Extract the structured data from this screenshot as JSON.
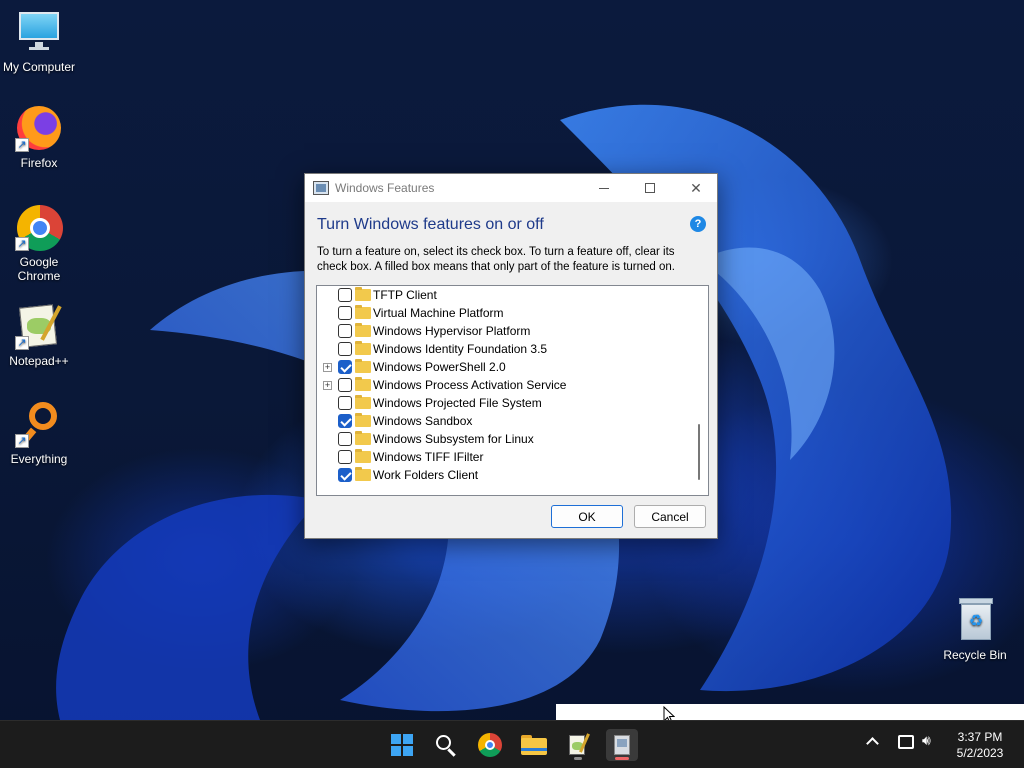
{
  "desktop": {
    "icons": [
      {
        "label": "My Computer",
        "icon": "monitor-icon"
      },
      {
        "label": "Firefox",
        "icon": "firefox-icon"
      },
      {
        "label": "Google Chrome",
        "icon": "chrome-icon"
      },
      {
        "label": "Notepad++",
        "icon": "notepadpp-icon"
      },
      {
        "label": "Everything",
        "icon": "search-magnifier-icon"
      },
      {
        "label": "Recycle Bin",
        "icon": "recycle-bin-icon"
      }
    ]
  },
  "dialog": {
    "title": "Windows Features",
    "heading": "Turn Windows features on or off",
    "description": "To turn a feature on, select its check box. To turn a feature off, clear its check box. A filled box means that only part of the feature is turned on.",
    "help_label": "?",
    "features": [
      {
        "label": "TFTP Client",
        "checked": false,
        "expandable": false
      },
      {
        "label": "Virtual Machine Platform",
        "checked": false,
        "expandable": false
      },
      {
        "label": "Windows Hypervisor Platform",
        "checked": false,
        "expandable": false
      },
      {
        "label": "Windows Identity Foundation 3.5",
        "checked": false,
        "expandable": false
      },
      {
        "label": "Windows PowerShell 2.0",
        "checked": true,
        "expandable": true
      },
      {
        "label": "Windows Process Activation Service",
        "checked": false,
        "expandable": true
      },
      {
        "label": "Windows Projected File System",
        "checked": false,
        "expandable": false
      },
      {
        "label": "Windows Sandbox",
        "checked": true,
        "expandable": false
      },
      {
        "label": "Windows Subsystem for Linux",
        "checked": false,
        "expandable": false
      },
      {
        "label": "Windows TIFF IFilter",
        "checked": false,
        "expandable": false
      },
      {
        "label": "Work Folders Client",
        "checked": true,
        "expandable": false
      }
    ],
    "ok_label": "OK",
    "cancel_label": "Cancel"
  },
  "taskbar": {
    "apps": [
      "start-icon",
      "search-icon",
      "chrome-icon",
      "file-explorer-icon",
      "notepadpp-icon",
      "windows-features-icon"
    ],
    "time": "3:37 PM",
    "date": "5/2/2023"
  },
  "colors": {
    "accent": "#1c5fc9",
    "heading": "#1e3a8a",
    "taskbar": "#1c1c1c"
  }
}
